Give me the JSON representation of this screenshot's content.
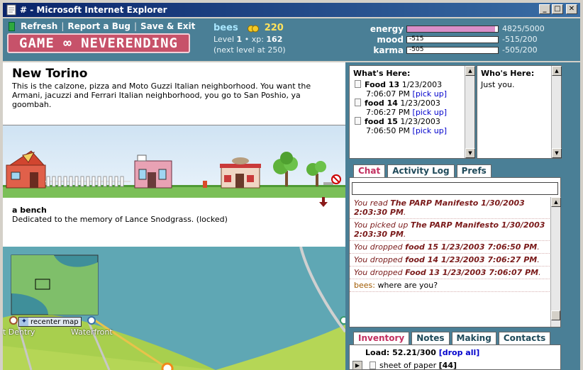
{
  "window": {
    "title": "# - Microsoft Internet Explorer",
    "min": "_",
    "max": "□",
    "close": "✕"
  },
  "header": {
    "refresh": "Refresh",
    "report": "Report a Bug",
    "save": "Save & Exit",
    "sep": "|",
    "logo": "GAME ∞ NEVERENDING",
    "player": "bees",
    "coins": "220",
    "level_label": "Level",
    "level": "1",
    "xp_label": "xp:",
    "xp": "162",
    "next_level": "(next level at 250)"
  },
  "stats": {
    "energy": {
      "label": "energy",
      "value": "4825/5000",
      "fraction": 0.965,
      "bar_text": ""
    },
    "mood": {
      "label": "mood",
      "value": "-515/200",
      "fraction": 0,
      "bar_text": "-515"
    },
    "karma": {
      "label": "karma",
      "value": "-505/200",
      "fraction": 0,
      "bar_text": "-505"
    }
  },
  "room": {
    "title": "New Torino",
    "description": "This is the calzone, pizza and Moto Guzzi Italian neighborhood. You want the Armani, jacuzzi and Ferrari Italian neighborhood, you go to San Poshio, ya goombah."
  },
  "item": {
    "title": "a bench",
    "description": "Dedicated to the memory of Lance Snodgrass. (locked)"
  },
  "map": {
    "recenter": "recenter map",
    "labels": [
      "t Dentry",
      "Waterfront"
    ]
  },
  "whats_here": {
    "title": "What's Here:",
    "items": [
      {
        "name": "Food 13",
        "date": "1/23/2003",
        "time": "7:06:07 PM",
        "action": "[pick up]"
      },
      {
        "name": "food 14",
        "date": "1/23/2003",
        "time": "7:06:27 PM",
        "action": "[pick up]"
      },
      {
        "name": "food 15",
        "date": "1/23/2003",
        "time": "7:06:50 PM",
        "action": "[pick up]"
      }
    ]
  },
  "whos_here": {
    "title": "Who's Here:",
    "text": "Just you."
  },
  "tabs": [
    "Chat",
    "Activity Log",
    "Prefs"
  ],
  "chat": {
    "messages": [
      {
        "pre": "You read ",
        "item": "The PARP Manifesto 1/30/2003 2:03:30 PM",
        "post": "."
      },
      {
        "pre": "You picked up ",
        "item": "The PARP Manifesto 1/30/2003 2:03:30 PM",
        "post": "."
      },
      {
        "pre": "You dropped ",
        "item": "food 15 1/23/2003 7:06:50 PM",
        "post": "."
      },
      {
        "pre": "You dropped ",
        "item": "food 14 1/23/2003 7:06:27 PM",
        "post": "."
      },
      {
        "pre": "You dropped ",
        "item": "Food 13 1/23/2003 7:06:07 PM",
        "post": "."
      }
    ],
    "say": {
      "who": "bees:",
      "text": "where are you?"
    }
  },
  "bottom_tabs": [
    "Inventory",
    "Notes",
    "Making",
    "Contacts"
  ],
  "inventory": {
    "load_label": "Load: 52.21/300",
    "drop_all": "[drop all]",
    "items": [
      {
        "name": "sheet of paper",
        "count": "[44]"
      }
    ]
  },
  "colors": {
    "header_bg": "#4a7f96",
    "logo_bg": "#c7526a",
    "link": "#0000cc",
    "chat_text": "#7a1a1a"
  }
}
